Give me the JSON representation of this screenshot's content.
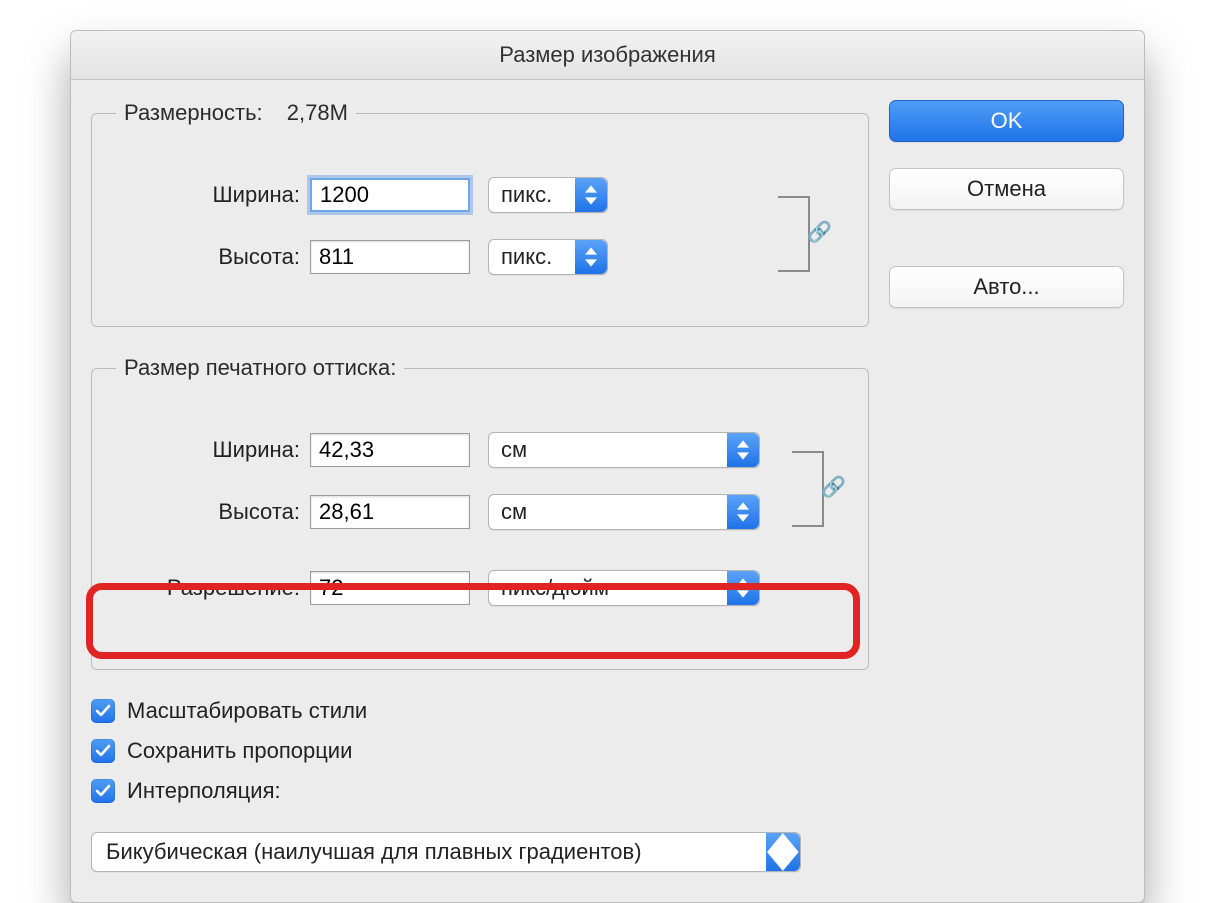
{
  "dialog": {
    "title": "Размер изображения"
  },
  "pixelGroup": {
    "legend": "Размерность:",
    "sizeReadout": "2,78M",
    "widthLabel": "Ширина:",
    "widthValue": "1200",
    "widthUnit": "пикс.",
    "heightLabel": "Высота:",
    "heightValue": "811",
    "heightUnit": "пикс."
  },
  "printGroup": {
    "legend": "Размер печатного оттиска:",
    "widthLabel": "Ширина:",
    "widthValue": "42,33",
    "widthUnit": "см",
    "heightLabel": "Высота:",
    "heightValue": "28,61",
    "heightUnit": "см",
    "resLabel": "Разрешение:",
    "resValue": "72",
    "resUnit": "пикс/дюйм"
  },
  "checks": {
    "scaleStyles": "Масштабировать стили",
    "constrain": "Сохранить пропорции",
    "resample": "Интерполяция:"
  },
  "resampleMethod": "Бикубическая (наилучшая для плавных градиентов)",
  "buttons": {
    "ok": "OK",
    "cancel": "Отмена",
    "auto": "Авто..."
  }
}
